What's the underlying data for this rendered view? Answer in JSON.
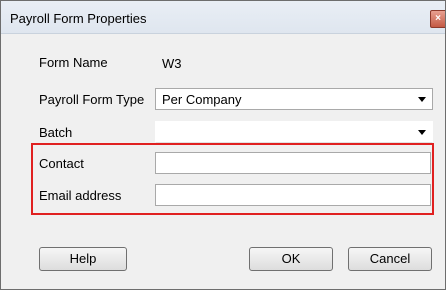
{
  "window": {
    "title": "Payroll Form Properties",
    "close_glyph": "×"
  },
  "form": {
    "form_name": {
      "label": "Form Name",
      "value": "W3"
    },
    "payroll_form_type": {
      "label": "Payroll Form Type",
      "value": "Per Company"
    },
    "batch": {
      "label": "Batch",
      "value": ""
    },
    "contact": {
      "label": "Contact",
      "value": ""
    },
    "email": {
      "label": "Email address",
      "value": ""
    }
  },
  "buttons": {
    "help": "Help",
    "ok": "OK",
    "cancel": "Cancel"
  },
  "colors": {
    "highlight": "#e02020",
    "dialog_bg": "#f0f0f0"
  }
}
